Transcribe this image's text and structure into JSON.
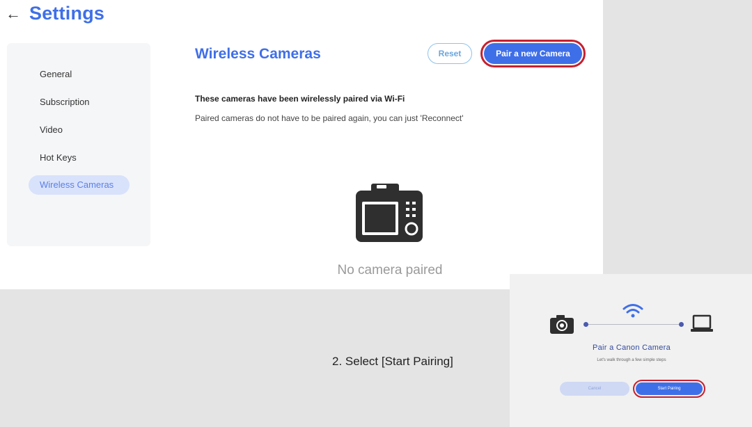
{
  "header": {
    "back_glyph": "←",
    "title": "Settings"
  },
  "sidebar": {
    "items": [
      {
        "label": "General",
        "active": false
      },
      {
        "label": "Subscription",
        "active": false
      },
      {
        "label": "Video",
        "active": false
      },
      {
        "label": "Hot Keys",
        "active": false
      },
      {
        "label": "Wireless Cameras",
        "active": true
      }
    ]
  },
  "main": {
    "title": "Wireless Cameras",
    "reset_label": "Reset",
    "pair_label": "Pair a new Camera",
    "info_heading": "These cameras have been wirelessly paired via Wi-Fi",
    "info_text": "Paired cameras do not have to be paired again, you can just 'Reconnect'",
    "empty_icon": "camera-icon",
    "empty_text": "No camera paired"
  },
  "caption": {
    "text": "2. Select [Start Pairing]"
  },
  "dialog": {
    "title": "Pair a Canon Camera",
    "subtitle": "Let's walk through a few simple steps",
    "cancel_label": "Cancel",
    "start_label": "Start Pairing",
    "icons": [
      "camera-icon",
      "wifi-icon",
      "laptop-icon"
    ]
  },
  "colors": {
    "accent": "#3f6fe8",
    "highlight_ring": "#c6202e",
    "sidebar_active_bg": "#d8e2fb",
    "reset_border": "#8ec2ec"
  }
}
